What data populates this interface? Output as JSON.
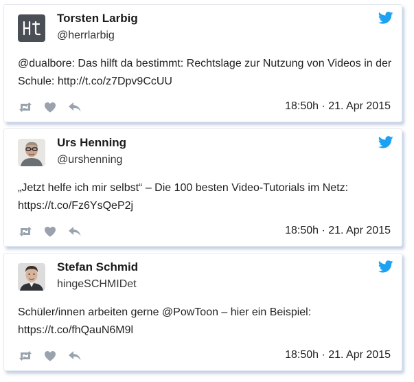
{
  "colors": {
    "twitter_blue": "#1da1f2",
    "action_gray": "#9aa3ad",
    "card_shadow": "#96aacd"
  },
  "tweets": [
    {
      "author_name": "Torsten Larbig",
      "handle": "@herrlarbig",
      "avatar_icon": "hl-monogram-avatar",
      "text": "@dualbore: Das hilft da bestimmt: Rechtslage zur Nutzung von Videos in der Schule: http://t.co/z7Dpv9CcUU",
      "timestamp": "18:50h · 21. Apr 2015",
      "icons": [
        "retweet-icon",
        "heart-icon",
        "reply-icon",
        "twitter-bird-icon"
      ]
    },
    {
      "author_name": "Urs Henning",
      "handle": "@urshenning",
      "avatar_icon": "person-photo-avatar",
      "text": "„Jetzt helfe ich mir selbst“ – Die 100 besten Video-Tutorials im Netz: https://t.co/Fz6YsQeP2j",
      "timestamp": "18:50h · 21. Apr 2015",
      "icons": [
        "retweet-icon",
        "heart-icon",
        "reply-icon",
        "twitter-bird-icon"
      ]
    },
    {
      "author_name": "Stefan Schmid",
      "handle": "hingeSCHMIDet",
      "avatar_icon": "person-photo-avatar",
      "text": "Schüler/innen arbeiten gerne @PowToon – hier ein Beispiel: https://t.co/fhQauN6M9l",
      "timestamp": "18:50h · 21. Apr 2015",
      "icons": [
        "retweet-icon",
        "heart-icon",
        "reply-icon",
        "twitter-bird-icon"
      ]
    }
  ]
}
